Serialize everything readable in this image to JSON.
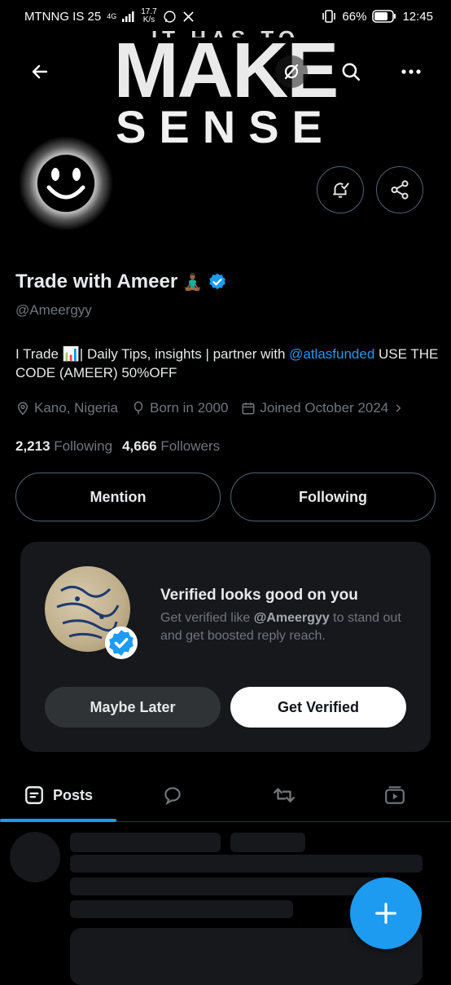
{
  "status": {
    "carrier": "MTNNG IS 25",
    "network": "4G",
    "speed_value": "17.7",
    "speed_unit": "K/s",
    "battery": "66%",
    "time": "12:45"
  },
  "banner": {
    "line_top": "IT HAS TO",
    "line_make": "MAKE",
    "line_sense": "SENSE"
  },
  "profile": {
    "name": "Trade with Ameer",
    "name_emoji": "🧘🏾‍♂️",
    "handle": "@Ameergyy",
    "bio_prefix": "I Trade 📊| Daily Tips, insights | partner with ",
    "bio_link": "@atlasfunded",
    "bio_suffix": " USE THE CODE (AMEER) 50%OFF",
    "location": "Kano, Nigeria",
    "born": "Born in 2000",
    "joined": "Joined October 2024",
    "following_count": "2,213",
    "following_label": "Following",
    "followers_count": "4,666",
    "followers_label": "Followers"
  },
  "actions": {
    "mention": "Mention",
    "following": "Following"
  },
  "verified_card": {
    "title": "Verified looks good on you",
    "text_prefix": "Get verified like ",
    "text_handle": "@Ameergyy",
    "text_suffix": " to stand out and get boosted reply reach.",
    "maybe_later": "Maybe Later",
    "get_verified": "Get Verified"
  },
  "tabs": {
    "posts": "Posts"
  },
  "colors": {
    "accent": "#1d9bf0",
    "background": "#000000",
    "card": "#16181c",
    "muted": "#71767b"
  }
}
